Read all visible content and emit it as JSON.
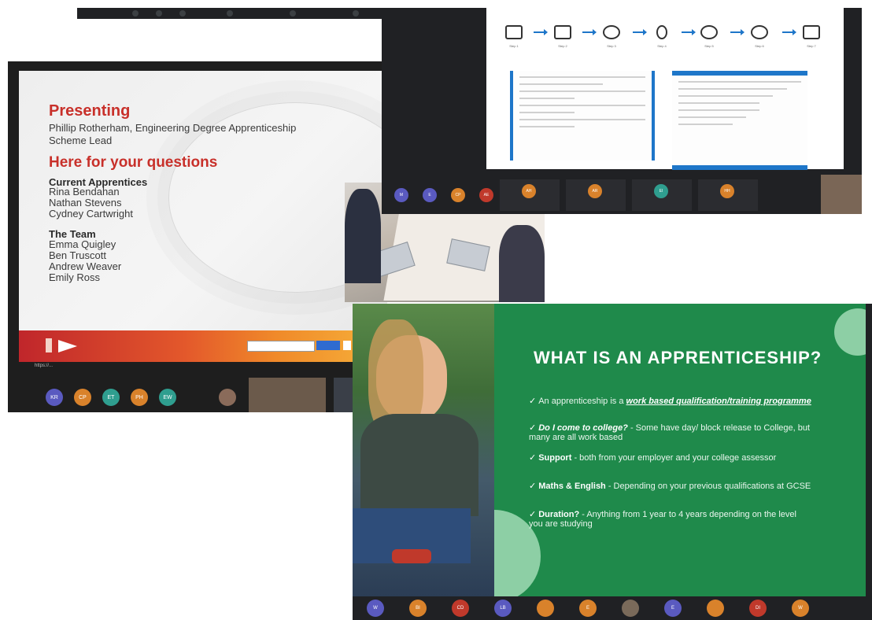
{
  "slide_presenting": {
    "heading": "Presenting",
    "presenter_line1": "Phillip Rotherham, Engineering Degree Apprenticeship",
    "presenter_line2": "Scheme Lead",
    "questions_heading": "Here for your questions",
    "apprentices_heading": "Current Apprentices",
    "apprentices": [
      "Rina Bendahan",
      "Nathan Stevens",
      "Cydney Cartwright"
    ],
    "team_heading": "The Team",
    "team": [
      "Emma Quigley",
      "Ben Truscott",
      "Andrew Weaver",
      "Emily Ross"
    ],
    "caption": "https://...",
    "participants": [
      {
        "initials": "KR",
        "color": "#5a5ac0"
      },
      {
        "initials": "CP",
        "color": "#d9822b"
      },
      {
        "initials": "ET",
        "color": "#2f9e8f"
      },
      {
        "initials": "PH",
        "color": "#d9822b"
      },
      {
        "initials": "EW",
        "color": "#2f9e8f"
      }
    ]
  },
  "slide_process": {
    "steps": [
      "Step 1",
      "Step 2",
      "Step 3",
      "Step 4",
      "Step 5",
      "Step 6",
      "Step 7"
    ],
    "step_icons": [
      "laptop-icon",
      "certificate-icon",
      "handshake-icon",
      "person-icon",
      "handshake-icon",
      "people-icon",
      "calendar-icon"
    ],
    "participants": [
      {
        "initials": "M",
        "color": "#5a5ac0"
      },
      {
        "initials": "E",
        "color": "#5a5ac0"
      },
      {
        "initials": "CP",
        "color": "#d9822b"
      },
      {
        "initials": "AE",
        "color": "#c0392b"
      },
      {
        "initials": "AH",
        "color": "#d9822b"
      },
      {
        "initials": "AR",
        "color": "#d9822b"
      },
      {
        "initials": "EI",
        "color": "#2f9e8f"
      },
      {
        "initials": "HH",
        "color": "#d9822b"
      }
    ]
  },
  "slide_apprenticeship": {
    "title": "WHAT IS AN APPRENTICESHIP?",
    "b1_text": "An apprenticeship is a ",
    "b1_link": "work based qualification/training programme",
    "b2_q": "Do I come to college?",
    "b2_text": " - Some have day/ block release to College, but many are all work based",
    "b3_bold": "Support",
    "b3_text": " - both from your employer and your college assessor",
    "b4_bold": "Maths & English",
    "b4_text": " - Depending on your previous qualifications at GCSE",
    "b5_bold": "Duration?",
    "b5_text": " - Anything from 1 year to 4 years depending on the level you are studying",
    "participants": [
      {
        "initials": "W",
        "color": "#5a5ac0"
      },
      {
        "initials": "BI",
        "color": "#d9822b"
      },
      {
        "initials": "CD",
        "color": "#c0392b"
      },
      {
        "initials": "LB",
        "color": "#5a5ac0"
      },
      {
        "initials": "",
        "color": "#d9822b"
      },
      {
        "initials": "E",
        "color": "#d9822b"
      },
      {
        "initials": "",
        "color": "#7a6a5a"
      },
      {
        "initials": "E",
        "color": "#5a5ac0"
      },
      {
        "initials": "",
        "color": "#d9822b"
      },
      {
        "initials": "DI",
        "color": "#c0392b"
      },
      {
        "initials": "W",
        "color": "#d9822b"
      }
    ]
  }
}
